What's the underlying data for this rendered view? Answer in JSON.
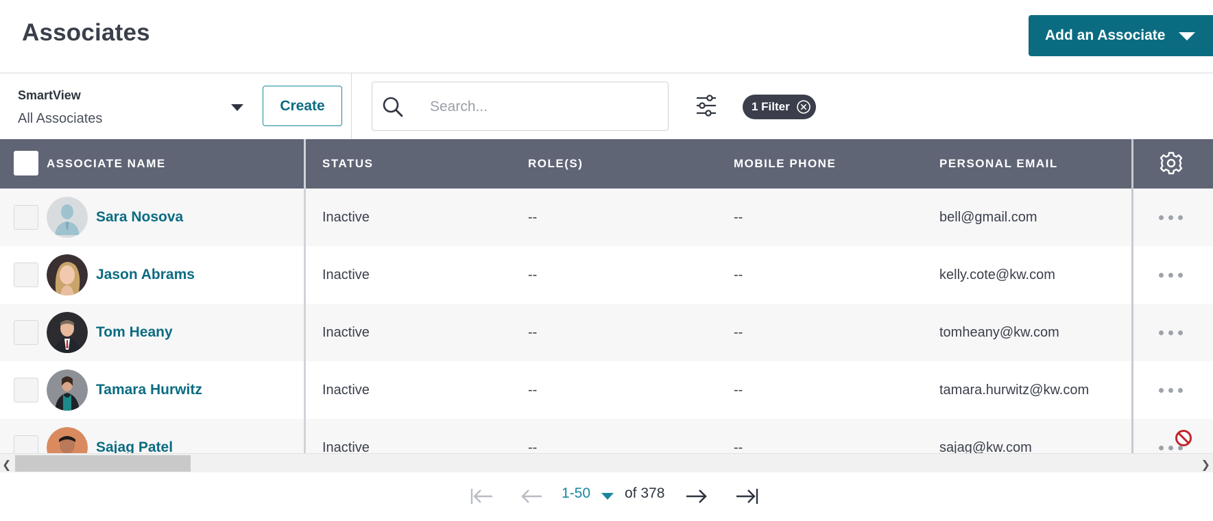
{
  "header": {
    "title": "Associates",
    "add_button_label": "Add an Associate"
  },
  "toolbar": {
    "smartview_label": "SmartView",
    "smartview_value": "All Associates",
    "create_label": "Create",
    "search_placeholder": "Search...",
    "search_value": "",
    "filter_chip_label": "1 Filter"
  },
  "table": {
    "columns": [
      "ASSOCIATE NAME",
      "STATUS",
      "ROLE(S)",
      "MOBILE PHONE",
      "PERSONAL EMAIL"
    ],
    "rows": [
      {
        "name": "Sara Nosova",
        "status": "Inactive",
        "roles": "--",
        "mobile": "--",
        "email": "bell@gmail.com",
        "avatar": "default-avatar"
      },
      {
        "name": "Jason Abrams",
        "status": "Inactive",
        "roles": "--",
        "mobile": "--",
        "email": "kelly.cote@kw.com",
        "avatar": "photo-avatar"
      },
      {
        "name": "Tom Heany",
        "status": "Inactive",
        "roles": "--",
        "mobile": "--",
        "email": "tomheany@kw.com",
        "avatar": "photo-avatar"
      },
      {
        "name": "Tamara Hurwitz",
        "status": "Inactive",
        "roles": "--",
        "mobile": "--",
        "email": "tamara.hurwitz@kw.com",
        "avatar": "photo-avatar"
      },
      {
        "name": "Sajag Patel",
        "status": "Inactive",
        "roles": "--",
        "mobile": "--",
        "email": "sajag@kw.com",
        "avatar": "photo-avatar"
      }
    ]
  },
  "pagination": {
    "range": "1-50",
    "of_total": "of 378"
  },
  "colors": {
    "primary": "#0b6c81",
    "accent": "#17899f",
    "header_bg": "#5f6575",
    "chip_bg": "#3a3f4b",
    "not_allowed": "#c0262d"
  },
  "icons": [
    "search-icon",
    "filter-sliders-icon",
    "close-circle-icon",
    "gear-icon",
    "more-dots-icon",
    "not-allowed-icon",
    "first-page-icon",
    "prev-page-icon",
    "next-page-icon",
    "last-page-icon"
  ]
}
